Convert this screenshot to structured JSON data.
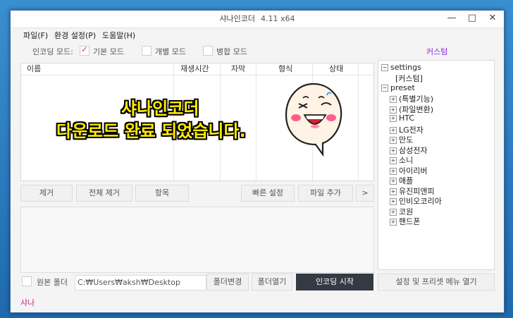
{
  "window": {
    "title": "샤나인코더",
    "version": "4.11 x64",
    "minimize": "—",
    "maximize": "□",
    "close": "✕"
  },
  "menu": [
    "파일(F)",
    "환경 설정(P)",
    "도움말(H)"
  ],
  "encoding_mode": {
    "label": "인코딩 모드:",
    "options": [
      {
        "label": "기본 모드",
        "checked": true
      },
      {
        "label": "개별 모드",
        "checked": false
      },
      {
        "label": "병합 모드",
        "checked": false
      }
    ]
  },
  "custom_label": "커스텀",
  "file_list": {
    "columns": [
      "이름",
      "재생시간",
      "자막",
      "형식",
      "상태"
    ]
  },
  "overlay": {
    "line1": "샤나인코더",
    "line2": "다운로드 완료 되었습니다."
  },
  "buttons": {
    "remove": "제거",
    "remove_all": "전체 제거",
    "item": "항목",
    "quick_settings": "빠른 설정",
    "add_file": "파일 추가",
    "more": ">",
    "change_folder": "폴더변경",
    "open_folder": "폴더열기",
    "start_encoding": "인코딩 시작",
    "settings_preset_menu": "설정 및 프리셋 메뉴 열기"
  },
  "source_folder": {
    "label": "원본 폴더",
    "checked": false,
    "path": "C:₩Users₩aksh₩Desktop"
  },
  "tree": {
    "settings": {
      "label": "settings",
      "expanded": true,
      "children": [
        "[커스텀]"
      ]
    },
    "preset": {
      "label": "preset",
      "expanded": true,
      "children": [
        "(특별기능)",
        "(파일변환)",
        "HTC",
        "LG전자",
        "만도",
        "삼성전자",
        "소니",
        "아이리버",
        "애플",
        "유진피앤피",
        "인비오코리아",
        "코원",
        "핸드폰"
      ]
    }
  },
  "status_text": "샤나",
  "colors": {
    "accent": "#8a2be2",
    "status": "#c0288a",
    "check": "#d9368c",
    "overlay_text": "#ffeb00",
    "start_button": "#333a44"
  }
}
